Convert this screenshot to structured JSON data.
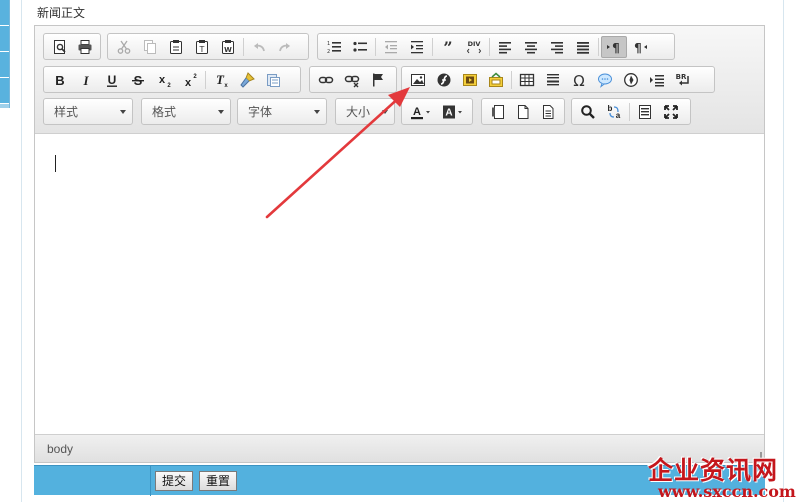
{
  "field_label": "新闻正文",
  "toolbar": {
    "row1_groups": [
      [
        "preview-icon",
        "print-icon"
      ],
      [
        "cut-icon",
        "copy-icon",
        "paste-icon",
        "paste-text-icon",
        "paste-word-icon",
        "undo-icon",
        "redo-icon"
      ],
      [
        "numbered-list-icon",
        "bulleted-list-icon",
        "outdent-icon",
        "indent-icon",
        "blockquote-icon",
        "div-icon",
        "align-left-icon",
        "align-center-icon",
        "align-right-icon",
        "justify-icon",
        "ltr-icon",
        "rtl-icon"
      ]
    ],
    "row2_groups": [
      [
        "bold-icon",
        "italic-icon",
        "underline-icon",
        "strike-icon",
        "subscript-icon",
        "superscript-icon",
        "remove-format-icon",
        "copy-format-icon",
        "paste-plain-icon"
      ],
      [
        "link-icon",
        "unlink-icon",
        "anchor-icon"
      ],
      [
        "image-icon",
        "flash-icon",
        "media-icon",
        "iframe-icon",
        "table-icon",
        "horizontal-rule-icon",
        "special-char-icon",
        "smiley-icon",
        "page-break-icon",
        "show-blocks-icon",
        "line-break-icon"
      ]
    ],
    "combos": {
      "styles": "样式",
      "format": "格式",
      "font": "字体",
      "size": "大小"
    }
  },
  "status_path": "body",
  "buttons": {
    "submit": "提交",
    "reset": "重置"
  },
  "watermark": {
    "title": "企业资讯网",
    "url": "www.sxccn.com"
  },
  "colors": {
    "action_bar": "#53b1de",
    "watermark": "#c4161c",
    "arrow": "#e3393c"
  }
}
